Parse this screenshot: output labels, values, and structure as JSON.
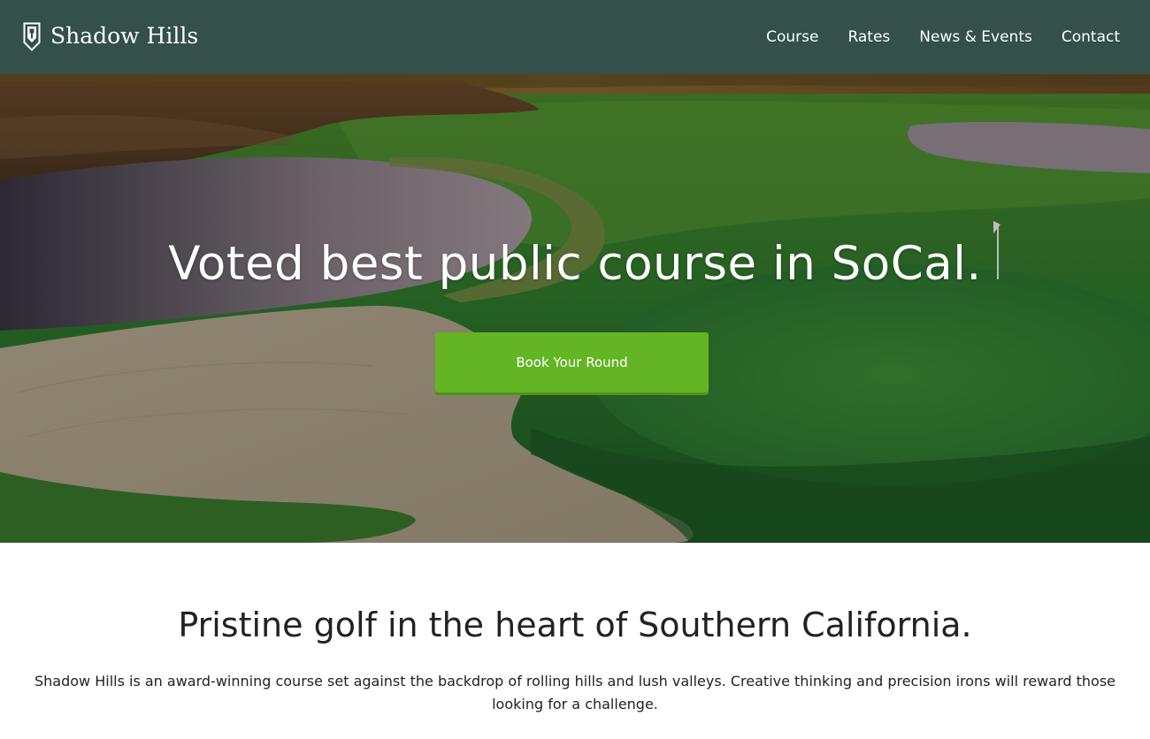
{
  "header": {
    "brand_name": "Shadow Hills",
    "brand_icon": "shield-crest-icon",
    "background_color": "#33504a",
    "nav": [
      {
        "label": "Course"
      },
      {
        "label": "Rates"
      },
      {
        "label": "News & Events"
      },
      {
        "label": "Contact"
      }
    ]
  },
  "hero": {
    "heading": "Voted best public course in SoCal.",
    "cta_label": "Book Your Round",
    "cta_color": "#63b523"
  },
  "intro": {
    "heading": "Pristine golf in the heart of Southern California.",
    "body": "Shadow Hills is an award-winning course set against the backdrop of rolling hills and lush valleys. Creative thinking and precision irons will reward those looking for a challenge."
  }
}
